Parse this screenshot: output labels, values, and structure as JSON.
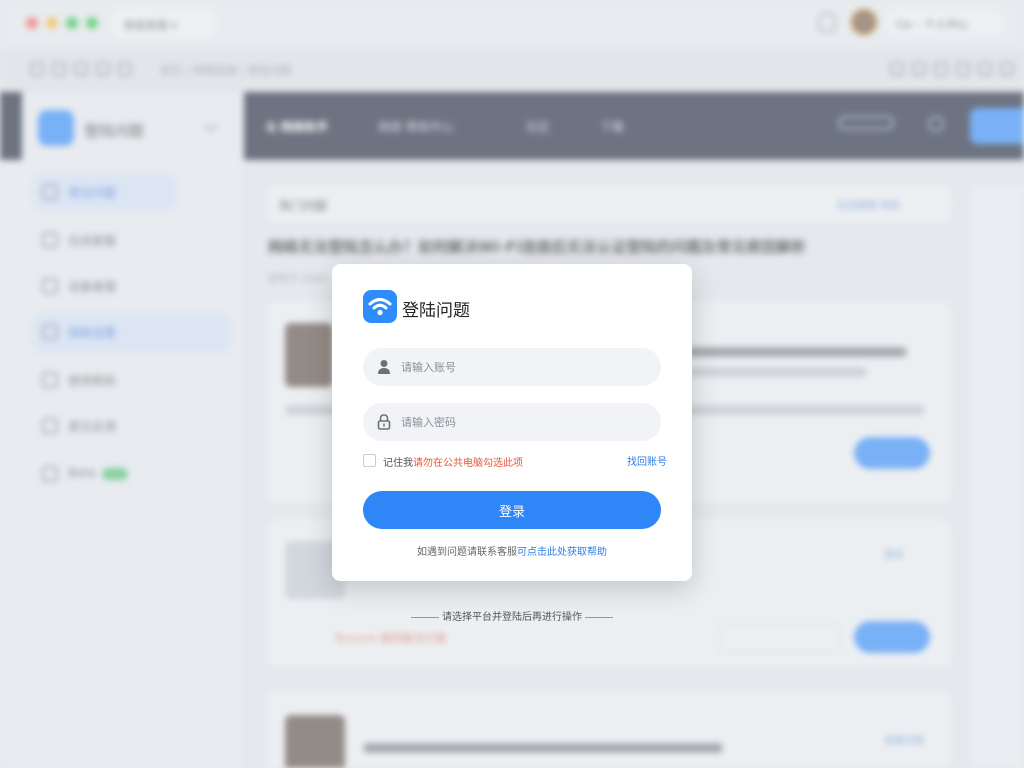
{
  "window": {
    "tab_label": "智能客服 ▾",
    "user_label": "Ca··· 个人中心",
    "traffic_lights": [
      "#ff5f57",
      "#febc2e",
      "#28c840"
    ]
  },
  "toolbar": {
    "breadcrumb": "首页 / 网络连接 / 登陆问题"
  },
  "sidebar": {
    "app_name": "登陆问题",
    "items": [
      {
        "label": "常见问题",
        "icon": "headset-icon",
        "active": true
      },
      {
        "label": "在线客服",
        "icon": "chat-icon",
        "active": false
      },
      {
        "label": "设备管理",
        "icon": "router-icon",
        "active": false
      },
      {
        "label": "网络设置",
        "icon": "settings-icon",
        "active": true
      },
      {
        "label": "使用帮助",
        "icon": "help-icon",
        "active": false
      },
      {
        "label": "意见反馈",
        "icon": "feedback-icon",
        "active": false
      },
      {
        "label": "Beta",
        "icon": "flask-icon",
        "active": false
      }
    ]
  },
  "navbar": {
    "brand": "Q 网络助手",
    "links": [
      "网络 帮助中心",
      "社区",
      "下载"
    ]
  },
  "content": {
    "card_title": "热门问题",
    "card_meta": "在线客服 帮助",
    "headline": "网络无法登陆怎么办？如何解决Wi-Fi连接后无法认证登陆的问题及常见原因解析",
    "subline": "发布于 2024",
    "red_tag": "Tencent 推荐解决方案",
    "action_label": "查看详情",
    "more_label": "更多"
  },
  "dialog": {
    "title": "登陆问题",
    "username_placeholder": "请输入账号",
    "password_placeholder": "请输入密码",
    "remember_label": "记住我",
    "remember_warning": "请勿在公共电脑勾选此项",
    "forgot_label": "找回账号",
    "login_button": "登录",
    "footer_text": "如遇到问题请联系客服",
    "footer_link": "可点击此处获取帮助",
    "below_text": "请选择平台并登陆后再进行操作"
  },
  "colors": {
    "accent": "#2f86f6",
    "warning": "#e8563a",
    "navbar_bg": "#1a2236"
  }
}
